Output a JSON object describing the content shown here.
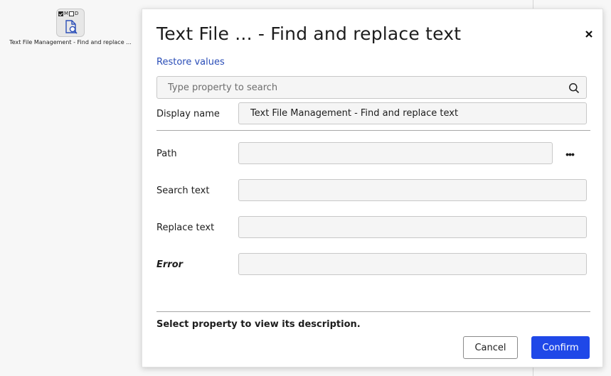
{
  "colors": {
    "accent": "#1f48e8",
    "link": "#2a4db7",
    "field_bg": "#f5f5f5",
    "canvas_bg": "#f7f7f7"
  },
  "activity": {
    "label": "Text File Management - Find and replace ...",
    "flags": [
      "M",
      "D"
    ],
    "icon": "document-search-icon"
  },
  "dialog": {
    "title": "Text File ... - Find and replace text",
    "close_icon": "close-icon",
    "restore_label": "Restore values",
    "search": {
      "placeholder": "Type property to search",
      "value": "",
      "icon": "search-icon"
    },
    "display_name": {
      "label": "Display name",
      "value": "Text File Management - Find and replace text"
    },
    "properties": {
      "path": {
        "label": "Path",
        "value": "",
        "browse_label": "•••"
      },
      "search_text": {
        "label": "Search text",
        "value": ""
      },
      "replace_text": {
        "label": "Replace text",
        "value": ""
      },
      "error": {
        "label": "Error",
        "value": ""
      }
    },
    "description": "Select property to view its description.",
    "buttons": {
      "cancel": "Cancel",
      "confirm": "Confirm"
    }
  }
}
